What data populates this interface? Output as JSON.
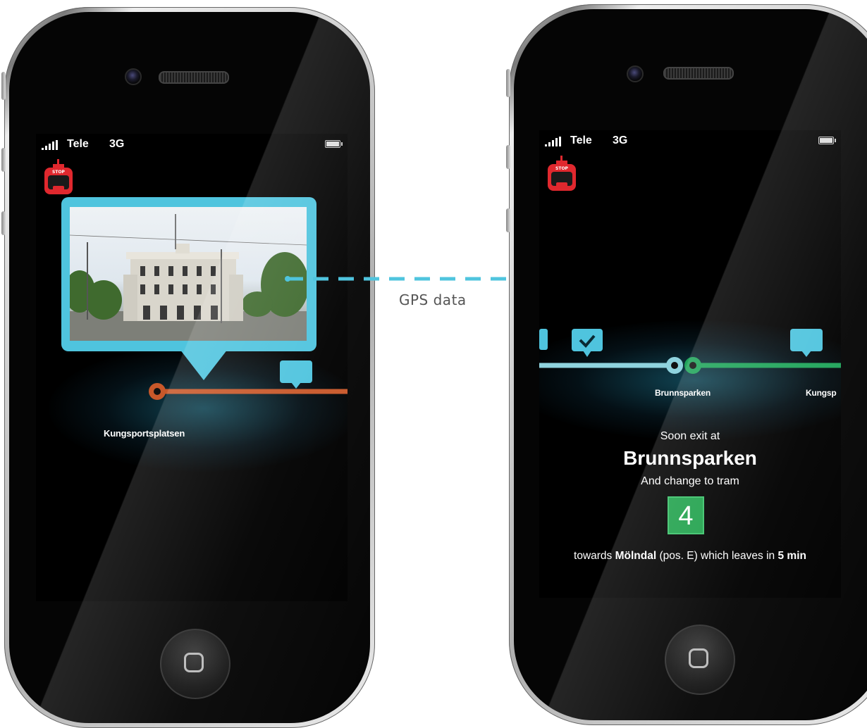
{
  "colors": {
    "accent_cyan": "#4fc4de",
    "route_orange": "#c8582a",
    "route_green": "#1fa45a",
    "stop_red": "#e0282e",
    "tram_green": "#21a24d"
  },
  "connector": {
    "label": "GPS data"
  },
  "left_phone": {
    "status": {
      "carrier": "Tele",
      "network": "3G"
    },
    "stop_button": {
      "icon": "stop-icon",
      "label": "STOP"
    },
    "current_stop": "Kungsportsplatsen",
    "message_icon": "chat-bubble-icon"
  },
  "right_phone": {
    "status": {
      "carrier": "Tele",
      "network": "3G"
    },
    "stop_button": {
      "icon": "stop-icon",
      "label": "STOP"
    },
    "route": {
      "stop_current": "Brunnsparken",
      "stop_next": "Kungsp"
    },
    "notice": {
      "soon_exit": "Soon exit at",
      "stop_name": "Brunnsparken",
      "change_to": "And change to tram",
      "tram_number": "4",
      "towards": "towards",
      "destination": "Mölndal",
      "position": "(pos. E) which leaves in",
      "leaves_in": "5 min"
    }
  }
}
